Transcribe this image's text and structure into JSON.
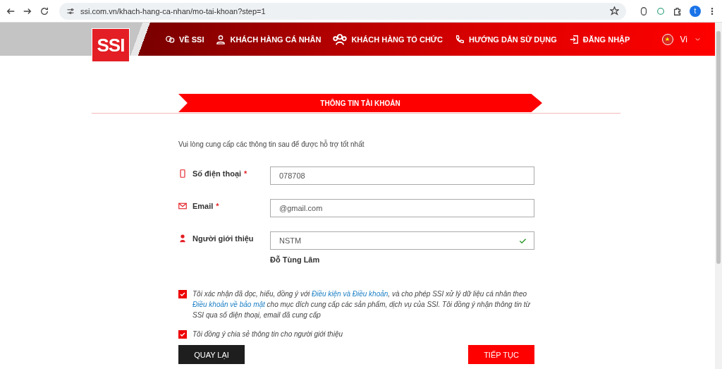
{
  "browser": {
    "url": "ssi.com.vn/khach-hang-ca-nhan/mo-tai-khoan?step=1",
    "profile_initial": "t"
  },
  "header": {
    "logo": "SSI",
    "language": "Vi",
    "nav": [
      {
        "label": "VỀ SSI"
      },
      {
        "label": "KHÁCH HÀNG CÁ NHÂN"
      },
      {
        "label": "KHÁCH HÀNG TỔ CHỨC"
      },
      {
        "label": "HƯỚNG DẪN SỬ DỤNG"
      },
      {
        "label": "ĐĂNG NHẬP"
      }
    ]
  },
  "step_banner": "THÔNG TIN TÀI KHOẢN",
  "intro": "Vui lòng cung cấp các thông tin sau để được hỗ trợ tốt nhất",
  "fields": [
    {
      "label": "Số điện thoại",
      "required_mark": "*",
      "value": "078708",
      "valid": false
    },
    {
      "label": "Email",
      "required_mark": "*",
      "value": "@gmail.com",
      "valid": false
    },
    {
      "label": "Người giới thiệu",
      "value": "NSTM",
      "valid": true,
      "note": "Đỗ Tùng Lâm"
    }
  ],
  "consents": [
    {
      "checked": true,
      "parts": [
        {
          "kind": "text",
          "text": "Tôi xác nhận đã đọc, hiểu, đồng ý với "
        },
        {
          "kind": "link",
          "text": "Điều kiện và Điều khoản"
        },
        {
          "kind": "text",
          "text": ", và cho phép SSI xử lý dữ liệu cá nhân theo "
        },
        {
          "kind": "link",
          "text": "Điều khoản về bảo mật"
        },
        {
          "kind": "text",
          "text": " cho mục đích cung cấp các sản phẩm, dịch vụ của SSI. Tôi đồng ý nhận thông tin từ SSI qua số điện thoại, email đã cung cấp"
        }
      ]
    },
    {
      "checked": true,
      "parts": [
        {
          "kind": "text",
          "text": "Tôi đồng ý chia sẻ thông tin cho người giới thiệu"
        }
      ]
    }
  ],
  "buttons": [
    {
      "label": "QUAY LẠI",
      "kind": "secondary"
    },
    {
      "label": "TIẾP TỤC",
      "kind": "primary"
    }
  ]
}
